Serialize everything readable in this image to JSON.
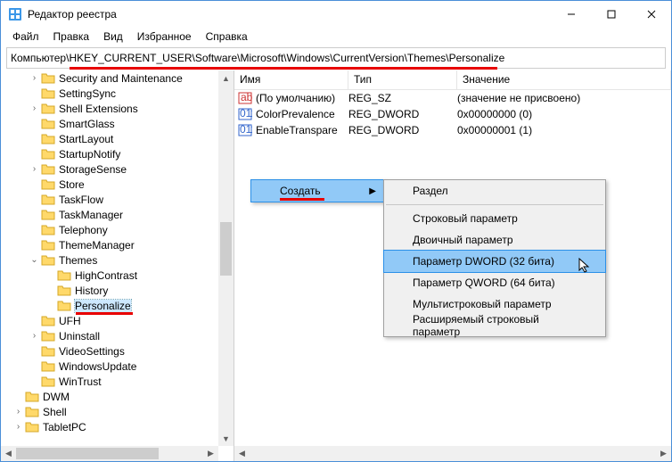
{
  "title": "Редактор реестра",
  "menu": {
    "file": "Файл",
    "edit": "Правка",
    "view": "Вид",
    "fav": "Избранное",
    "help": "Справка"
  },
  "address": {
    "prefix": "Компьютер\\",
    "path": "HKEY_CURRENT_USER\\Software\\Microsoft\\Windows\\CurrentVersion\\Themes\\Personalize"
  },
  "tree": [
    {
      "d": 4,
      "e": ">",
      "t": "Security and Maintenance"
    },
    {
      "d": 4,
      "e": "",
      "t": "SettingSync"
    },
    {
      "d": 4,
      "e": ">",
      "t": "Shell Extensions"
    },
    {
      "d": 4,
      "e": "",
      "t": "SmartGlass"
    },
    {
      "d": 4,
      "e": "",
      "t": "StartLayout"
    },
    {
      "d": 4,
      "e": "",
      "t": "StartupNotify"
    },
    {
      "d": 4,
      "e": ">",
      "t": "StorageSense"
    },
    {
      "d": 4,
      "e": "",
      "t": "Store"
    },
    {
      "d": 4,
      "e": "",
      "t": "TaskFlow"
    },
    {
      "d": 4,
      "e": "",
      "t": "TaskManager"
    },
    {
      "d": 4,
      "e": "",
      "t": "Telephony"
    },
    {
      "d": 4,
      "e": "",
      "t": "ThemeManager"
    },
    {
      "d": 4,
      "e": "v",
      "t": "Themes"
    },
    {
      "d": 5,
      "e": "",
      "t": "HighContrast"
    },
    {
      "d": 5,
      "e": "",
      "t": "History"
    },
    {
      "d": 5,
      "e": "",
      "t": "Personalize",
      "sel": true,
      "ul": true
    },
    {
      "d": 4,
      "e": "",
      "t": "UFH"
    },
    {
      "d": 4,
      "e": ">",
      "t": "Uninstall"
    },
    {
      "d": 4,
      "e": "",
      "t": "VideoSettings"
    },
    {
      "d": 4,
      "e": "",
      "t": "WindowsUpdate"
    },
    {
      "d": 4,
      "e": "",
      "t": "WinTrust"
    },
    {
      "d": 3,
      "e": "",
      "t": "DWM"
    },
    {
      "d": 3,
      "e": ">",
      "t": "Shell"
    },
    {
      "d": 3,
      "e": ">",
      "t": "TabletPC"
    }
  ],
  "list": {
    "head": {
      "name": "Имя",
      "type": "Тип",
      "value": "Значение"
    },
    "rows": [
      {
        "ic": "str",
        "n": "(По умолчанию)",
        "t": "REG_SZ",
        "v": "(значение не присвоено)"
      },
      {
        "ic": "bin",
        "n": "ColorPrevalence",
        "t": "REG_DWORD",
        "v": "0x00000000 (0)"
      },
      {
        "ic": "bin",
        "n": "EnableTranspare",
        "t": "REG_DWORD",
        "v": "0x00000001 (1)"
      }
    ]
  },
  "ctx": {
    "create": "Создать",
    "items": [
      {
        "t": "Раздел"
      },
      {
        "sep": true
      },
      {
        "t": "Строковый параметр"
      },
      {
        "t": "Двоичный параметр"
      },
      {
        "t": "Параметр DWORD (32 бита)",
        "hl": true
      },
      {
        "t": "Параметр QWORD (64 бита)"
      },
      {
        "t": "Мультистроковый параметр"
      },
      {
        "t": "Расширяемый строковый параметр"
      }
    ]
  }
}
